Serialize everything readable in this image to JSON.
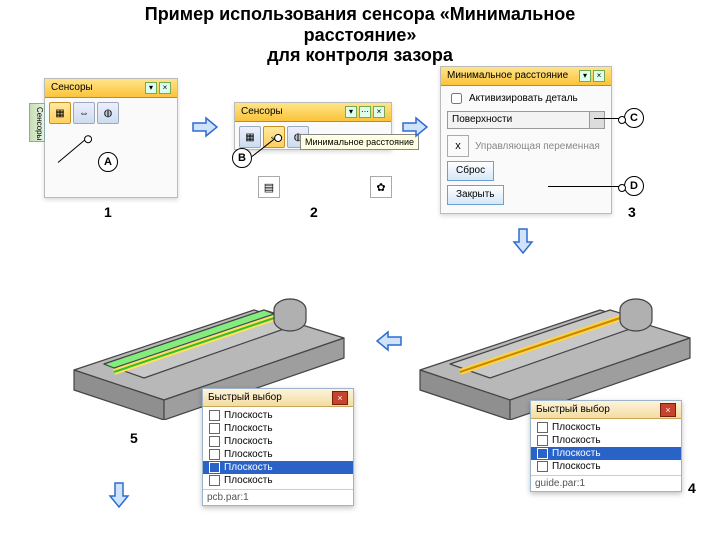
{
  "title_line1": "Пример использования сенсора «Минимальное",
  "title_line2": "расстояние»",
  "title_line3": "для контроля зазора",
  "steps": {
    "s1": "1",
    "s2": "2",
    "s3": "3",
    "s4": "4",
    "s5": "5"
  },
  "marks": {
    "a": "A",
    "b": "B",
    "c": "C",
    "d": "D"
  },
  "panel": {
    "sensors_title": "Сенсоры",
    "min_dist_title": "Минимальное расстояние",
    "tooltip": "Минимальное расстояние",
    "activate_part": "Активизировать деталь",
    "surfaces": "Поверхности",
    "ctrl_var": "Управляющая переменная",
    "reset": "Сброс",
    "close": "Закрыть"
  },
  "vtab": "Сенсоры",
  "quick": {
    "title": "Быстрый выбор",
    "items": [
      "Плоскость",
      "Плоскость",
      "Плоскость",
      "Плоскость",
      "Плоскость",
      "Плоскость"
    ],
    "items4": [
      "Плоскость",
      "Плоскость",
      "Плоскость",
      "Плоскость"
    ],
    "footer5": "pcb.par:1",
    "footer4": "guide.par:1"
  },
  "icons": {
    "cube": "▦",
    "dist": "⇔",
    "sphere": "◍",
    "chart": "▤",
    "gear": "✿",
    "checkbox_sel": "☑"
  }
}
